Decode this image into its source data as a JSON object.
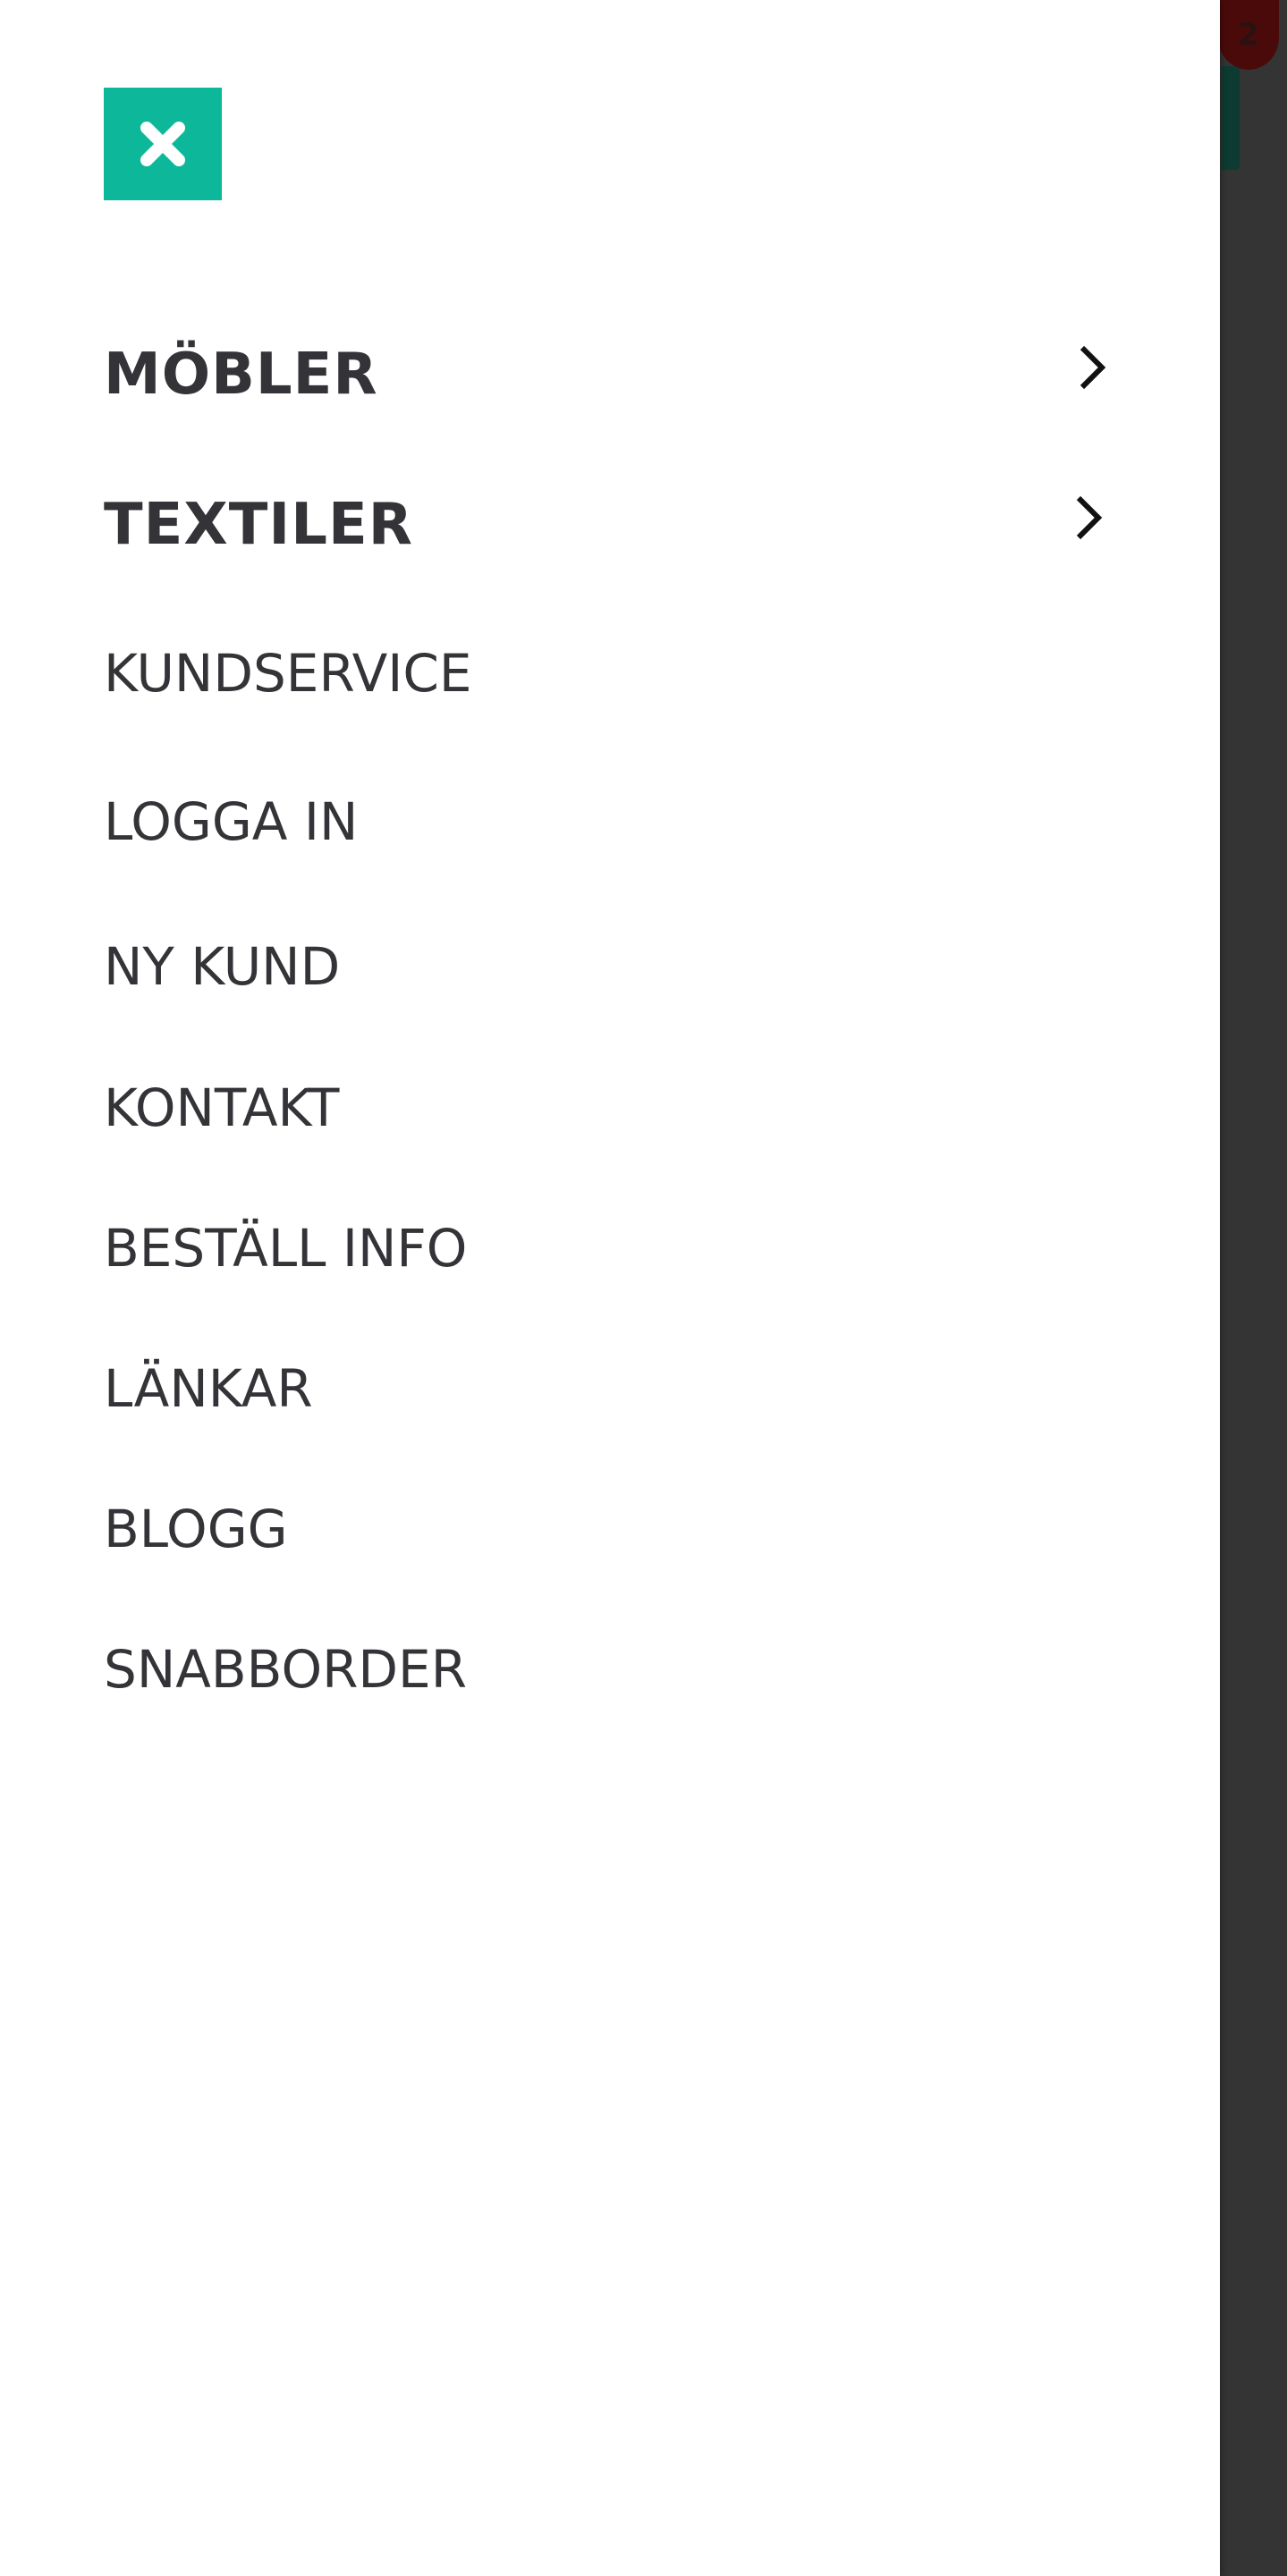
{
  "backdrop": {
    "cart_count": "2",
    "accent_color": "#0d3b32",
    "badge_color": "#4a0a0a"
  },
  "drawer": {
    "close_icon": "close-icon",
    "close_color": "#0db89a",
    "menu": [
      {
        "label": "MÖBLER",
        "has_submenu": true,
        "icon": "chevron-right-icon"
      },
      {
        "label": "TEXTILER",
        "has_submenu": true,
        "icon": "chevron-right-icon"
      },
      {
        "label": "KUNDSERVICE",
        "has_submenu": false
      },
      {
        "label": "LOGGA IN",
        "has_submenu": false
      },
      {
        "label": "NY KUND",
        "has_submenu": false
      },
      {
        "label": "KONTAKT",
        "has_submenu": false
      },
      {
        "label": "BESTÄLL INFO",
        "has_submenu": false
      },
      {
        "label": "LÄNKAR",
        "has_submenu": false
      },
      {
        "label": "BLOGG",
        "has_submenu": false
      },
      {
        "label": "SNABBORDER",
        "has_submenu": false
      }
    ]
  }
}
